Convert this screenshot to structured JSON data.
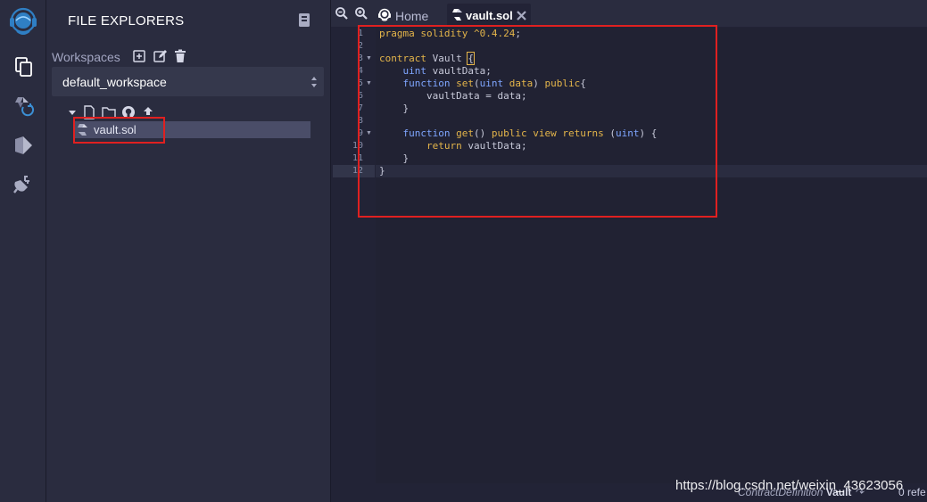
{
  "sidebar": {
    "title": "FILE EXPLORERS",
    "workspaces_label": "Workspaces",
    "workspace_selected": "default_workspace",
    "files": [
      {
        "name": "vault.sol"
      }
    ]
  },
  "tabs": [
    {
      "label": "Home",
      "active": false
    },
    {
      "label": "vault.sol",
      "active": true
    }
  ],
  "editor": {
    "line_numbers": [
      "1",
      "2",
      "3",
      "4",
      "5",
      "6",
      "7",
      "8",
      "9",
      "10",
      "11",
      "12"
    ],
    "folded_lines": [
      "3",
      "5",
      "9"
    ],
    "current_line": "12"
  },
  "status": {
    "definition_label": "ContractDefinition",
    "definition_name": "Vault",
    "refs": "0 refe"
  },
  "watermark": "https://blog.csdn.net/weixin_43623056",
  "colors": {
    "accent": "#e4b54a",
    "highlight_box": "#e02020",
    "type_color": "#7fa6ff",
    "panel_bg": "#2a2c3f",
    "editor_bg": "#222336"
  },
  "icons": {
    "rail": [
      "remix-logo",
      "file-explorer-icon",
      "solidity-compiler-icon",
      "deploy-icon",
      "plugin-manager-icon"
    ],
    "workspace": [
      "add-workspace-icon",
      "edit-workspace-icon",
      "delete-workspace-icon"
    ],
    "tree": [
      "caret-down-icon",
      "new-file-icon",
      "new-folder-icon",
      "github-icon",
      "upload-icon"
    ]
  }
}
